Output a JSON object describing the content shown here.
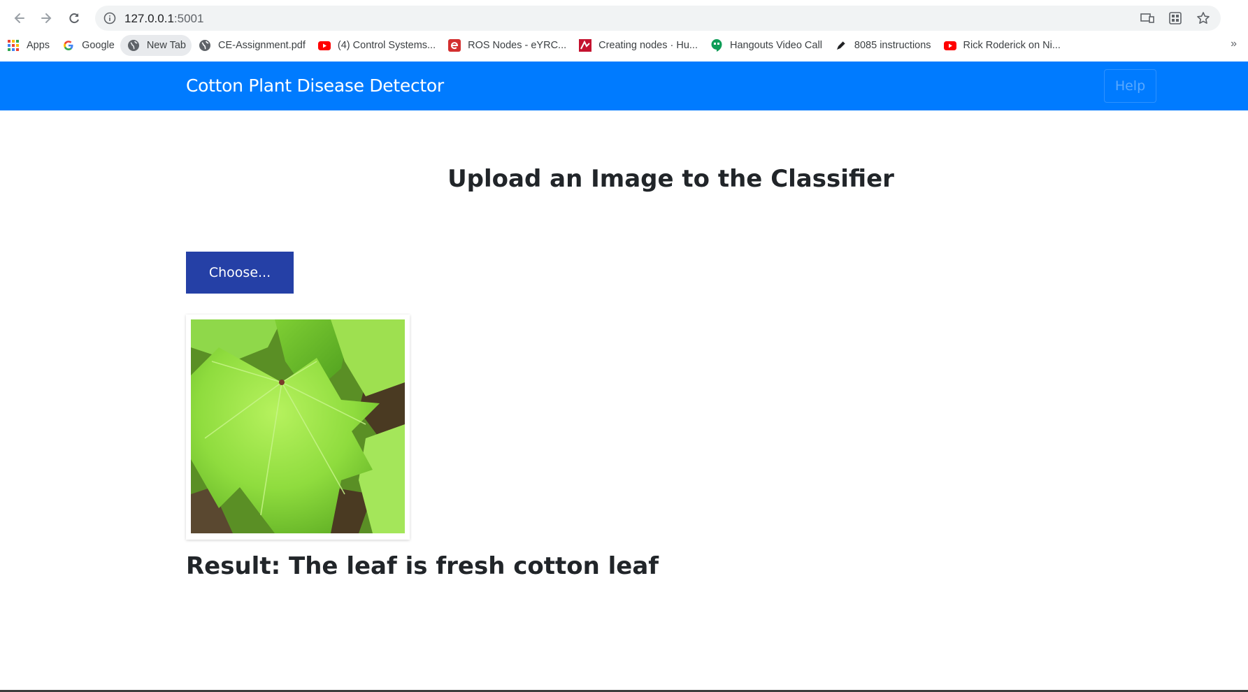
{
  "browser": {
    "url_host": "127.0.0.1",
    "url_port": ":5001",
    "bookmarks": [
      {
        "label": "Apps",
        "icon": "apps-grid-icon"
      },
      {
        "label": "Google",
        "icon": "google-icon"
      },
      {
        "label": "New Tab",
        "icon": "globe-icon"
      },
      {
        "label": "CE-Assignment.pdf",
        "icon": "globe-icon"
      },
      {
        "label": "(4) Control Systems...",
        "icon": "youtube-icon"
      },
      {
        "label": "ROS Nodes - eYRC...",
        "icon": "eyantra-icon"
      },
      {
        "label": "Creating nodes · Hu...",
        "icon": "huggingface-icon"
      },
      {
        "label": "Hangouts Video Call",
        "icon": "hangouts-icon"
      },
      {
        "label": "8085 instructions",
        "icon": "pen-icon"
      },
      {
        "label": "Rick Roderick on Ni...",
        "icon": "youtube-icon"
      }
    ],
    "more_label": "»"
  },
  "navbar": {
    "brand": "Cotton Plant Disease Detector",
    "help_label": "Help"
  },
  "main": {
    "title": "Upload an Image to the Classifier",
    "choose_label": "Choose...",
    "result_text": "Result: The leaf is fresh cotton leaf"
  },
  "colors": {
    "navbar": "#007bff",
    "choose_button": "#2540a6",
    "leaf_light": "#9be84a",
    "leaf_dark": "#4fa61f",
    "soil": "#4a3a22"
  }
}
